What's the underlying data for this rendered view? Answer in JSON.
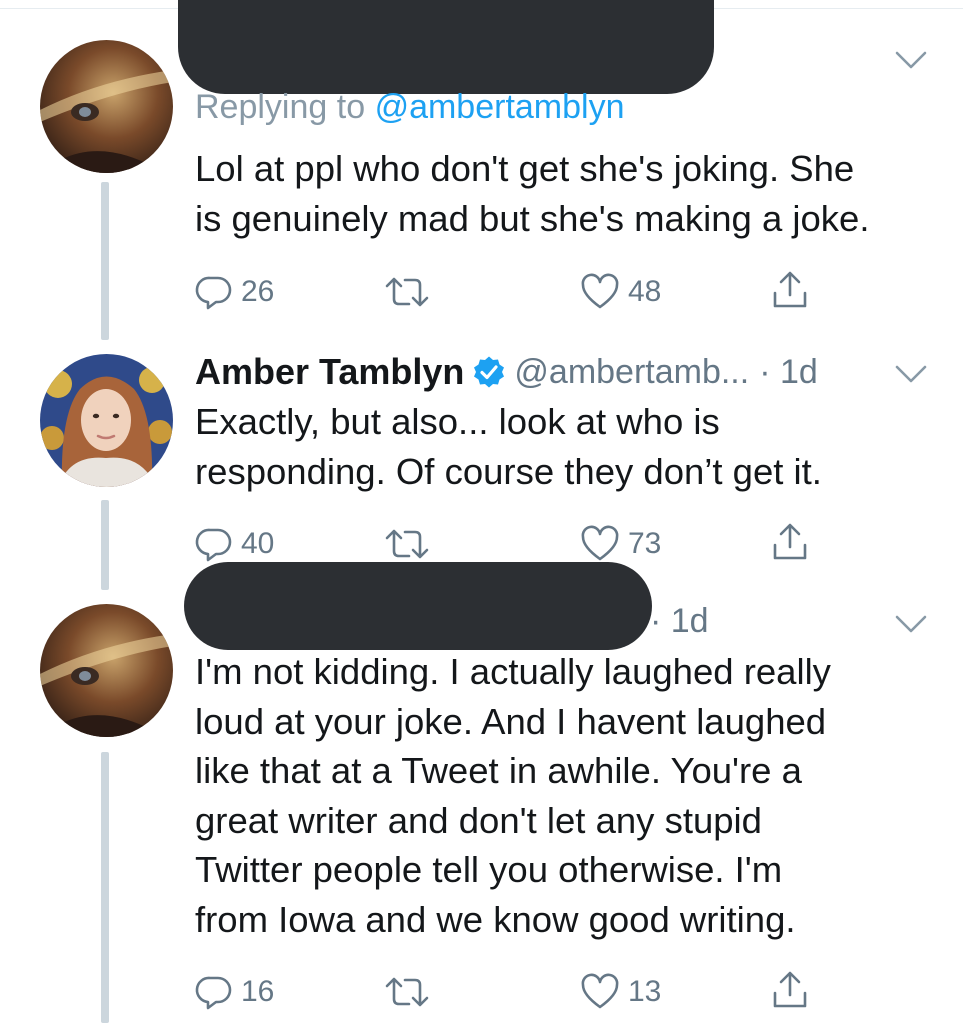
{
  "tweets": [
    {
      "replying_label": "Replying to",
      "replying_handle": "@ambertamblyn",
      "lines": [
        "Lol at ppl who don't get she's joking. She",
        "is genuinely mad but she's making a joke."
      ],
      "actions": {
        "reply_count": "26",
        "like_count": "48"
      }
    },
    {
      "display_name": "Amber Tamblyn",
      "handle": "@ambertamb...",
      "timestamp": "· 1d",
      "lines": [
        "Exactly, but also... look at who is",
        "responding. Of course they don’t get it."
      ],
      "actions": {
        "reply_count": "40",
        "like_count": "73"
      }
    },
    {
      "timestamp": "· 1d",
      "lines": [
        "I'm not kidding. I actually laughed really",
        "loud at your joke. And I havent laughed",
        "like that at a Tweet in awhile. You're a",
        "great writer and don't let any stupid",
        "Twitter people tell you otherwise. I'm",
        "from Iowa and we know good writing."
      ],
      "actions": {
        "reply_count": "16",
        "like_count": "13"
      }
    }
  ],
  "colors": {
    "text": "#14171a",
    "secondary": "#657786",
    "link": "#1da1f2",
    "thread_line": "#ccd6dd",
    "redaction": "#2c2f33"
  },
  "icons": [
    "reply-icon",
    "retweet-icon",
    "like-icon",
    "share-icon",
    "chevron-down-icon",
    "verified-badge-icon"
  ]
}
